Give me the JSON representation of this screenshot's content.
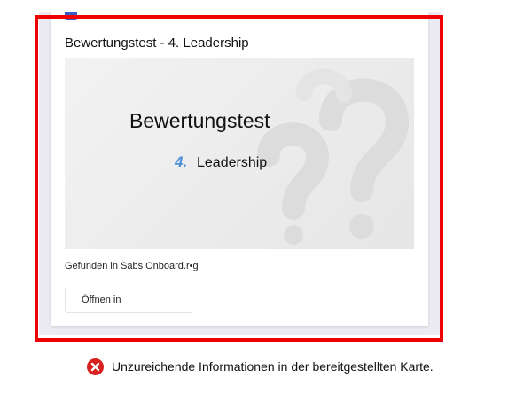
{
  "card": {
    "title": "Bewertungstest - 4. Leadership",
    "hero": {
      "title": "Bewertungstest",
      "number": "4.",
      "subtitle": "Leadership"
    },
    "found_in": "Gefunden in Sabs Onboard.r•g",
    "open_button": "Öffnen in"
  },
  "feedback": {
    "icon": "error-x-icon",
    "text": "Unzureichende Informationen in der bereitgestellten Karte."
  },
  "colors": {
    "highlight_frame": "#ee0000",
    "error_icon": "#d92121",
    "hero_number": "#4a90d9",
    "card_backdrop": "#ecebf4"
  }
}
